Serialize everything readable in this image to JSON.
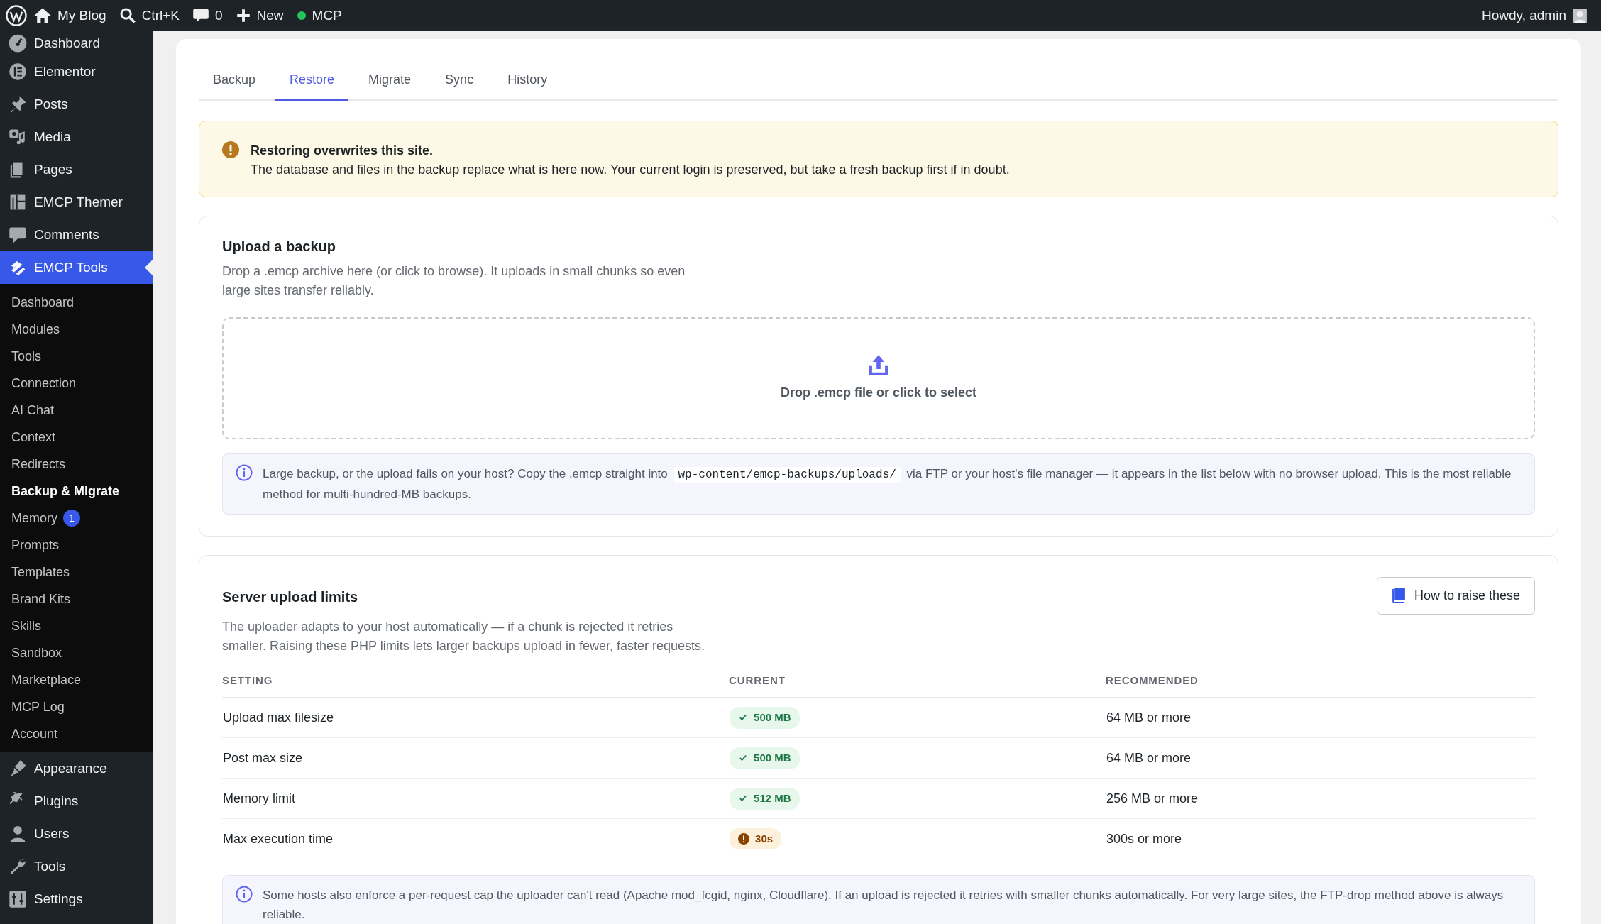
{
  "admin_bar": {
    "site": "My Blog",
    "search": "Ctrl+K",
    "comments": "0",
    "new": "New",
    "mcp": {
      "label": "MCP",
      "color": "#22c55e"
    },
    "greeting": "Howdy, admin"
  },
  "sidebar": {
    "items": [
      {
        "label": "Dashboard",
        "selected": false
      },
      {
        "label": "Elementor",
        "selected": false
      },
      {
        "label": "Posts",
        "selected": false
      },
      {
        "label": "Media",
        "selected": false
      },
      {
        "label": "Pages",
        "selected": false
      },
      {
        "label": "EMCP Themer",
        "selected": false
      },
      {
        "label": "Comments",
        "selected": false
      },
      {
        "label": "EMCP Tools",
        "selected": true,
        "children": [
          {
            "label": "Dashboard",
            "selected": false
          },
          {
            "label": "Modules",
            "selected": false
          },
          {
            "label": "Tools",
            "selected": false
          },
          {
            "label": "Connection",
            "selected": false
          },
          {
            "label": "AI Chat",
            "selected": false
          },
          {
            "label": "Context",
            "selected": false
          },
          {
            "label": "Redirects",
            "selected": false
          },
          {
            "label": "Backup & Migrate",
            "selected": true
          },
          {
            "label": "Memory",
            "selected": false,
            "badge": "1"
          },
          {
            "label": "Prompts",
            "selected": false
          },
          {
            "label": "Templates",
            "selected": false
          },
          {
            "label": "Brand Kits",
            "selected": false
          },
          {
            "label": "Skills",
            "selected": false
          },
          {
            "label": "Sandbox",
            "selected": false
          },
          {
            "label": "Marketplace",
            "selected": false
          },
          {
            "label": "MCP Log",
            "selected": false
          },
          {
            "label": "Account",
            "selected": false
          }
        ]
      },
      {
        "label": "Appearance",
        "selected": false
      },
      {
        "label": "Plugins",
        "selected": false
      },
      {
        "label": "Users",
        "selected": false
      },
      {
        "label": "Tools",
        "selected": false
      },
      {
        "label": "Settings",
        "selected": false
      }
    ]
  },
  "tabs": [
    {
      "label": "Backup",
      "selected": false
    },
    {
      "label": "Restore",
      "selected": true
    },
    {
      "label": "Migrate",
      "selected": false
    },
    {
      "label": "Sync",
      "selected": false
    },
    {
      "label": "History",
      "selected": false
    }
  ],
  "alert": {
    "title": "Restoring overwrites this site.",
    "text": "The database and files in the backup replace what is here now. Your current login is preserved, but take a fresh backup first if in doubt."
  },
  "upload": {
    "title": "Upload a backup",
    "description": "Drop a .emcp archive here (or click to browse). It uploads in small chunks so even large sites transfer reliably.",
    "dropzone_label": "Drop .emcp file or click to select",
    "note": {
      "text_before": "Large backup, or the upload fails on your host? Copy the .emcp straight into",
      "code": "wp-content/emcp-backups/uploads/",
      "text_after": "via FTP or your host's file manager — it appears in the list below with no browser upload. This is the most reliable method for multi-hundred-MB backups."
    }
  },
  "limits": {
    "title": "Server upload limits",
    "button": "How to raise these",
    "description": "The uploader adapts to your host automatically — if a chunk is rejected it retries smaller. Raising these PHP limits lets larger backups upload in fewer, faster requests.",
    "columns": [
      "SETTING",
      "CURRENT",
      "RECOMMENDED"
    ],
    "rows": [
      {
        "setting": "Upload max filesize",
        "current": {
          "value": "500 MB",
          "kind": "ok"
        },
        "recommended": "64 MB or more"
      },
      {
        "setting": "Post max size",
        "current": {
          "value": "500 MB",
          "kind": "ok"
        },
        "recommended": "64 MB or more"
      },
      {
        "setting": "Memory limit",
        "current": {
          "value": "512 MB",
          "kind": "ok"
        },
        "recommended": "256 MB or more"
      },
      {
        "setting": "Max execution time",
        "current": {
          "value": "30s",
          "kind": "warning"
        },
        "recommended": "300s or more"
      }
    ],
    "note": "Some hosts also enforce a per-request cap the uploader can't read (Apache mod_fcgid, nginx, Cloudflare). If an upload is rejected it retries with smaller chunks automatically. For very large sites, the FTP-drop method above is always reliable."
  }
}
